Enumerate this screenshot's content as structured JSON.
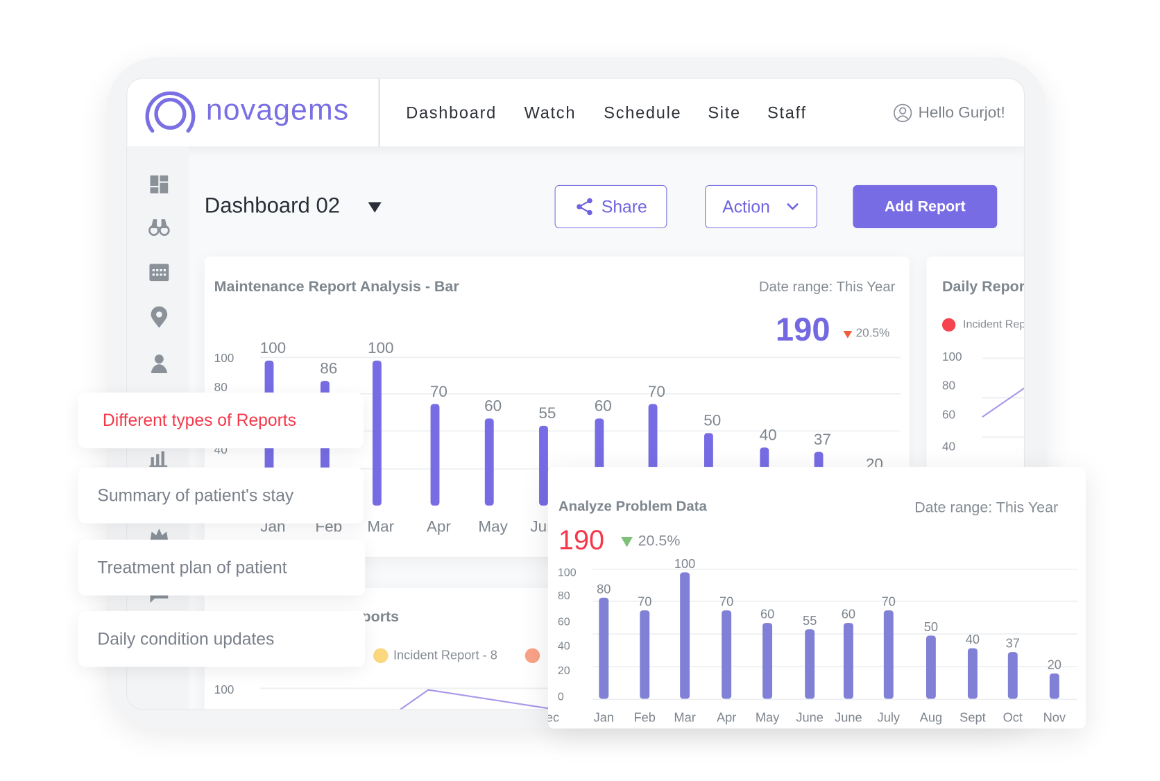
{
  "brand": {
    "name": "novagems",
    "color": "#7a6fe3"
  },
  "nav": {
    "items": [
      "Dashboard",
      "Watch",
      "Schedule",
      "Site",
      "Staff"
    ],
    "greeting": "Hello Gurjot!"
  },
  "sidebar": {
    "icons": [
      "dashboard-icon",
      "binoculars-icon",
      "calendar-icon",
      "location-pin-icon",
      "user-icon",
      "bar-chart-icon",
      "crown-icon",
      "chat-icon"
    ]
  },
  "toolbar": {
    "title": "Dashboard 02",
    "share": "Share",
    "action": "Action",
    "add_report": "Add Report"
  },
  "feature_list": [
    "Different types of Reports",
    "Summary of patient's stay",
    "Treatment plan of patient",
    "Daily condition updates"
  ],
  "colors": {
    "accent": "#776ce4",
    "highlight_red": "#f5384a",
    "bar_secondary": "#8080d6"
  },
  "maintenance_card": {
    "title": "Maintenance Report Analysis - Bar",
    "date_range": "Date range: This Year",
    "total": "190",
    "change": "20.5%"
  },
  "daily_card": {
    "title": "Daily Repor",
    "legend": "Incident Rep",
    "yticks": [
      "100",
      "80",
      "60",
      "40"
    ]
  },
  "reports_card": {
    "title": "Reports",
    "legend": [
      "Incident Report - 8",
      ""
    ],
    "ytick": "100"
  },
  "problem_card": {
    "title": "Analyze Problem Data",
    "date_range": "Date range: This Year",
    "total": "190",
    "change": "20.5%"
  },
  "chart_data": [
    {
      "type": "bar",
      "title": "Maintenance Report Analysis - Bar",
      "categories": [
        "Jan",
        "Feb",
        "Mar",
        "Apr",
        "May",
        "June",
        "",
        "",
        "",
        "",
        "",
        ""
      ],
      "values": [
        100,
        86,
        100,
        70,
        60,
        55,
        60,
        70,
        50,
        40,
        37,
        20
      ],
      "yticks": [
        "100",
        "80",
        "40"
      ],
      "ylim": [
        0,
        100
      ],
      "grid": true
    },
    {
      "type": "bar",
      "title": "Analyze Problem Data",
      "categories": [
        "Jan",
        "Feb",
        "Mar",
        "Apr",
        "May",
        "June",
        "June",
        "July",
        "Aug",
        "Sept",
        "Oct",
        "Nov",
        "Dec"
      ],
      "values": [
        80,
        70,
        100,
        70,
        60,
        55,
        60,
        70,
        50,
        40,
        37,
        20
      ],
      "yticks": [
        "100",
        "80",
        "60",
        "40",
        "20",
        "0"
      ],
      "ylim": [
        0,
        100
      ],
      "grid": true
    }
  ]
}
